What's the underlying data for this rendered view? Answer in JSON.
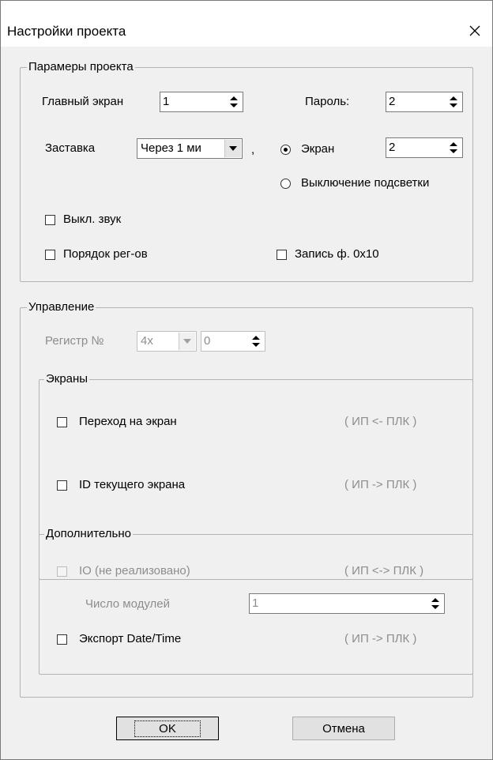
{
  "window": {
    "title": "Настройки проекта",
    "close_icon": "close-icon"
  },
  "project_params": {
    "legend": "Парамеры проекта",
    "main_screen": {
      "label": "Главный экран",
      "value": "1"
    },
    "password": {
      "label": "Пароль:",
      "value": "2"
    },
    "screensaver": {
      "label": "Заставка",
      "value": "Через 1 ми",
      "separator": ","
    },
    "radio_screen": {
      "label": "Экран",
      "value": "2",
      "checked": true
    },
    "radio_backlight": {
      "label": "Выключение подсветки",
      "checked": false
    },
    "sound_off": {
      "label": "Выкл. звук",
      "checked": false
    },
    "reg_order": {
      "label": "Порядок рег-ов",
      "checked": false
    },
    "write_f": {
      "label": "Запись ф. 0x10",
      "checked": false
    }
  },
  "control": {
    "legend": "Управление",
    "register": {
      "label": "Регистр №",
      "type_value": "4x",
      "number_value": "0"
    },
    "screens": {
      "legend": "Экраны",
      "goto_screen": {
        "label": "Переход на экран",
        "direction": "( ИП <- ПЛК )",
        "checked": false
      },
      "current_screen_id": {
        "label": "ID текущего экрана",
        "direction": "( ИП -> ПЛК )",
        "checked": false
      }
    },
    "extra": {
      "legend": "Дополнительно",
      "io": {
        "label": "IO (не реализовано)",
        "direction": "( ИП <-> ПЛК )",
        "checked": false
      },
      "modules": {
        "label": "Число модулей",
        "value": "1"
      },
      "export_datetime": {
        "label": "Экспорт Date/Time",
        "direction": "( ИП -> ПЛК )",
        "checked": false
      }
    }
  },
  "buttons": {
    "ok": "OK",
    "cancel": "Отмена"
  }
}
